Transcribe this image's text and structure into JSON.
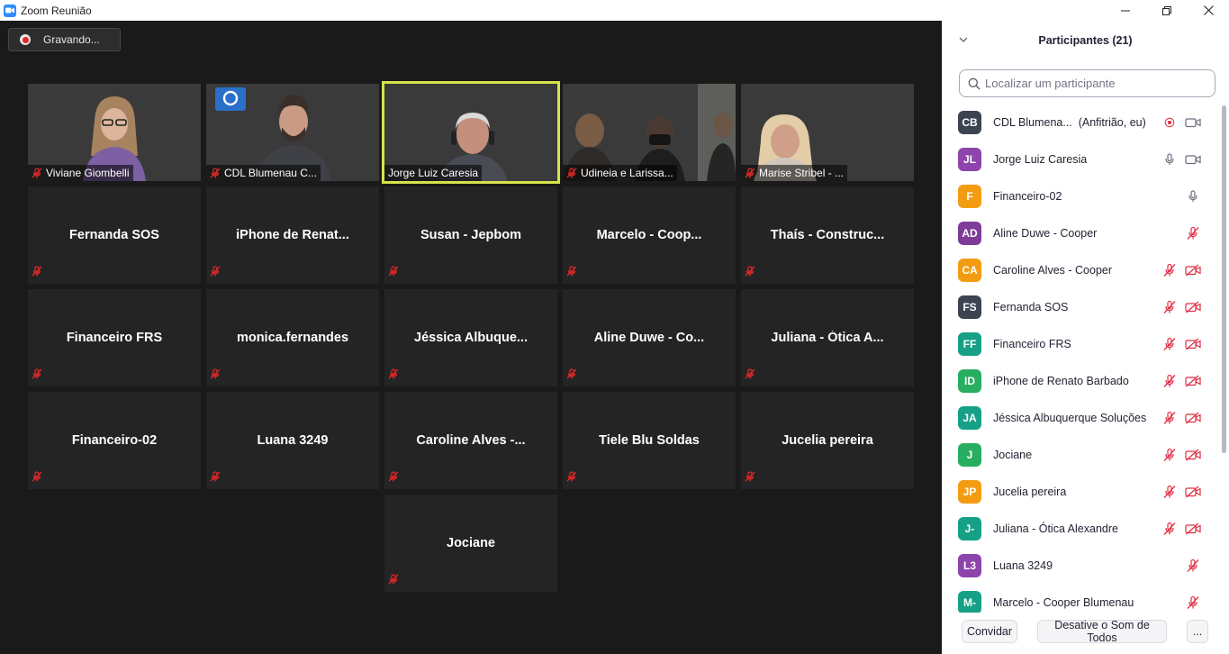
{
  "window": {
    "title": "Zoom Reunião"
  },
  "recording": {
    "label": "Gravando..."
  },
  "video_tiles": [
    {
      "name": "Viviane Giombelli",
      "muted": true
    },
    {
      "name": "CDL Blumenau C...",
      "muted": true
    },
    {
      "name": "Jorge Luiz Caresia",
      "muted": false,
      "active_speaker": true
    },
    {
      "name": "Udineia e Larissa...",
      "muted": true
    },
    {
      "name": "Marise Stribel - ...",
      "muted": true
    }
  ],
  "name_tiles": [
    {
      "name": "Fernanda SOS"
    },
    {
      "name": "iPhone de Renat..."
    },
    {
      "name": "Susan - Jepbom"
    },
    {
      "name": "Marcelo - Coop..."
    },
    {
      "name": "Thaís - Construc..."
    },
    {
      "name": "Financeiro FRS"
    },
    {
      "name": "monica.fernandes"
    },
    {
      "name": "Jéssica Albuque..."
    },
    {
      "name": "Aline Duwe - Co..."
    },
    {
      "name": "Juliana - Ótica A..."
    },
    {
      "name": "Financeiro-02"
    },
    {
      "name": "Luana 3249"
    },
    {
      "name": "Caroline Alves -..."
    },
    {
      "name": "Tiele Blu Soldas"
    },
    {
      "name": "Jucelia pereira"
    },
    {
      "name": "Jociane"
    }
  ],
  "participants_panel": {
    "title": "Participantes (21)",
    "search_placeholder": "Localizar um participante",
    "participants": [
      {
        "initials": "CB",
        "name": "CDL Blumena...",
        "suffix": "(Anfitrião, eu)",
        "color": "#3c4452",
        "mic": "none",
        "recording": true,
        "camera": "on"
      },
      {
        "initials": "JL",
        "name": "Jorge Luiz Caresia",
        "color": "#8e44ad",
        "mic": "on",
        "camera": "on"
      },
      {
        "initials": "F",
        "name": "Financeiro-02",
        "color": "#f39c12",
        "mic": "on",
        "camera": "none"
      },
      {
        "initials": "AD",
        "name": "Aline Duwe - Cooper",
        "color": "#7d3c98",
        "mic": "muted",
        "camera": "none"
      },
      {
        "initials": "CA",
        "name": "Caroline Alves - Cooper",
        "color": "#f39c12",
        "mic": "muted",
        "camera": "off"
      },
      {
        "initials": "FS",
        "name": "Fernanda SOS",
        "color": "#3c4452",
        "mic": "muted",
        "camera": "off"
      },
      {
        "initials": "FF",
        "name": "Financeiro FRS",
        "color": "#16a085",
        "mic": "muted",
        "camera": "off"
      },
      {
        "initials": "ID",
        "name": "iPhone de Renato Barbado",
        "color": "#27ae60",
        "mic": "muted",
        "camera": "off"
      },
      {
        "initials": "JA",
        "name": "Jéssica Albuquerque Soluções",
        "color": "#16a085",
        "mic": "muted",
        "camera": "off"
      },
      {
        "initials": "J",
        "name": "Jociane",
        "color": "#27ae60",
        "mic": "muted",
        "camera": "off"
      },
      {
        "initials": "JP",
        "name": "Jucelia pereira",
        "color": "#f39c12",
        "mic": "muted",
        "camera": "off"
      },
      {
        "initials": "J-",
        "name": "Juliana - Ótica Alexandre",
        "color": "#16a085",
        "mic": "muted",
        "camera": "off"
      },
      {
        "initials": "L3",
        "name": "Luana 3249",
        "color": "#8e44ad",
        "mic": "muted",
        "camera": "none"
      },
      {
        "initials": "M-",
        "name": "Marcelo - Cooper Blumenau",
        "color": "#16a085",
        "mic": "muted",
        "camera": "none"
      }
    ],
    "footer": {
      "invite": "Convidar",
      "mute_all": "Desative o Som de Todos",
      "more": "..."
    }
  },
  "colors": {
    "accent_red": "#e02828",
    "active_speaker": "#d7e24b",
    "panel_muted_icon": "#e02f44"
  }
}
